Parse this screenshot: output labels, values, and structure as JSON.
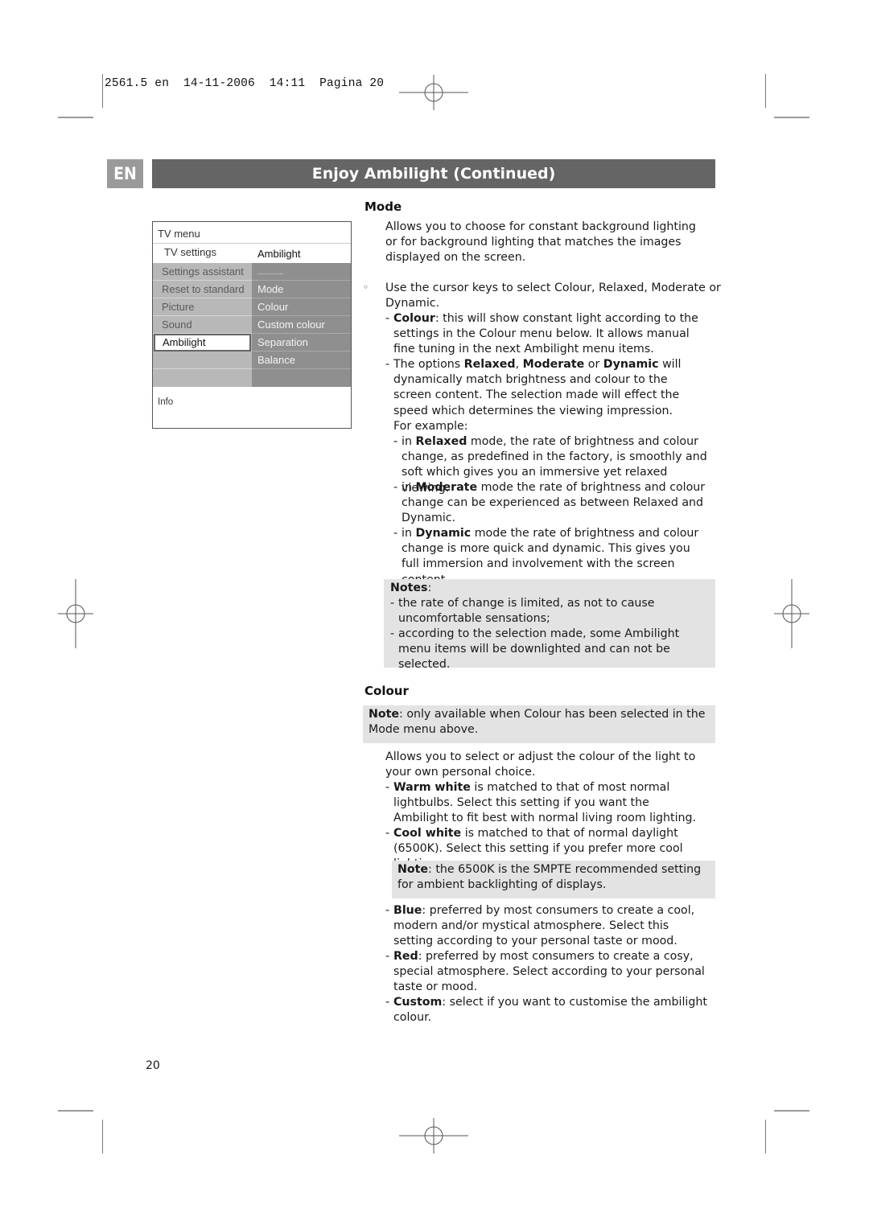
{
  "print_header": {
    "job": "2561.5 en",
    "date": "14-11-2006",
    "time": "14:11",
    "page_label": "Pagina 20"
  },
  "section": {
    "language_tag": "EN",
    "title": "Enjoy Ambilight  (Continued)"
  },
  "tv_menu": {
    "header": "TV menu",
    "breadcrumb_left": "TV settings",
    "breadcrumb_right": "Ambilight",
    "left_items": [
      {
        "label": "Settings assistant",
        "selected": false
      },
      {
        "label": "Reset to standard",
        "selected": false
      },
      {
        "label": "Picture",
        "selected": false
      },
      {
        "label": "Sound",
        "selected": false
      },
      {
        "label": "Ambilight",
        "selected": true
      },
      {
        "label": "",
        "selected": false
      },
      {
        "label": "",
        "selected": false
      }
    ],
    "right_items": [
      {
        "label": "............."
      },
      {
        "label": "Mode"
      },
      {
        "label": "Colour"
      },
      {
        "label": "Custom colour"
      },
      {
        "label": "Separation"
      },
      {
        "label": "Balance"
      },
      {
        "label": ""
      }
    ],
    "info_label": "Info"
  },
  "mode": {
    "heading": "Mode",
    "intro": "Allows you to choose for constant background lighting or for background lighting that matches the images displayed on the screen.",
    "instruction": "Use the cursor keys to select Colour, Relaxed, Moderate or Dynamic.",
    "colour_item": {
      "term": "Colour",
      "text": ": this will show constant light according to the settings in the Colour menu below. It allows manual fine tuning in the next Ambilight menu items."
    },
    "options_item": {
      "pre": "The options ",
      "t1": "Relaxed",
      "sep1": ", ",
      "t2": "Moderate",
      "sep2": " or ",
      "t3": "Dynamic",
      "post": " will dynamically match brightness and colour to the screen content. The selection made will effect the speed which determines the viewing impression.",
      "example_label": "For example:"
    },
    "examples": [
      {
        "pre": "in ",
        "term": "Relaxed",
        "text": " mode, the rate of brightness and colour change, as predefined in the factory, is smoothly and soft which gives you an immersive yet relaxed viewing."
      },
      {
        "pre": "in ",
        "term": "Moderate",
        "text": " mode the rate of brightness and colour change can be experienced as between Relaxed and Dynamic."
      },
      {
        "pre": "in ",
        "term": "Dynamic",
        "text": " mode the rate of brightness and colour change is more quick and dynamic. This gives you full immersion and involvement with the screen content."
      }
    ],
    "notes": {
      "label": "Notes",
      "items": [
        "the rate of change is limited, as not to cause uncomfortable sensations;",
        "according to the selection made, some Ambilight menu items will be downlighted and can not be selected."
      ]
    }
  },
  "colour": {
    "heading": "Colour",
    "note": {
      "label": "Note",
      "text": ": only available when Colour has been selected in the Mode menu above."
    },
    "intro": "Allows you to select or adjust the colour of the light to your own personal choice.",
    "items_a": [
      {
        "term": "Warm white",
        "text": " is matched to that of most normal lightbulbs. Select this setting if you want the Ambilight to fit best with normal living room lighting."
      },
      {
        "term": "Cool white",
        "text": " is matched to that of normal daylight (6500K). Select this setting if you prefer more cool lighting."
      }
    ],
    "smpte_note": {
      "label": "Note",
      "text": ": the 6500K is the SMPTE recommended setting for ambient backlighting of displays."
    },
    "items_b": [
      {
        "term": "Blue",
        "text": ": preferred by most consumers to create a cool, modern and/or mystical atmosphere. Select this setting according to your personal taste or mood."
      },
      {
        "term": "Red",
        "text": ": preferred by most consumers to create a cosy, special atmosphere. Select according to your personal taste or mood."
      },
      {
        "term": "Custom",
        "text": ": select if you want to customise the ambilight colour."
      }
    ]
  },
  "footer": {
    "page_number": "20"
  },
  "glyphs": {
    "dash": "-",
    "bullet": "◦",
    "colon": ":"
  }
}
